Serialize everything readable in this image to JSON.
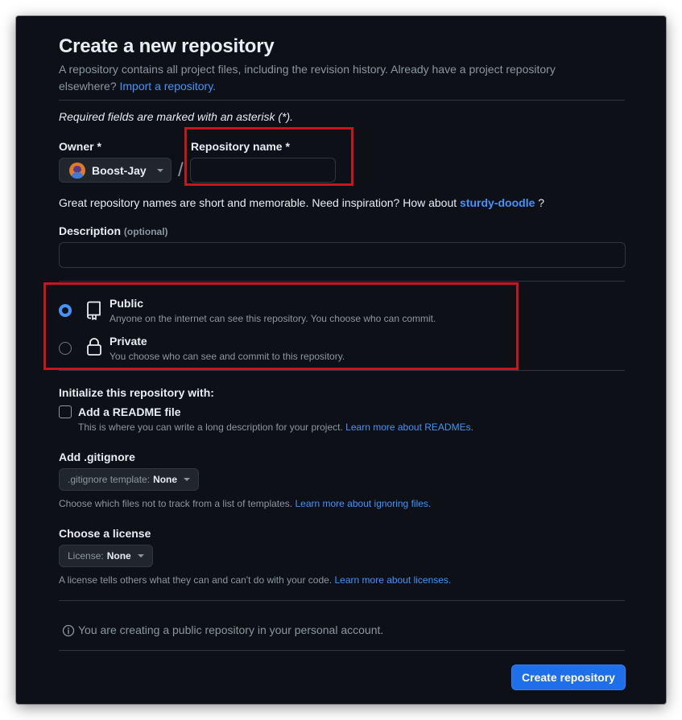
{
  "page": {
    "title": "Create a new repository",
    "subtitle_text": "A repository contains all project files, including the revision history. Already have a project repository elsewhere?",
    "import_link": "Import a repository.",
    "required_note": "Required fields are marked with an asterisk (*)."
  },
  "owner": {
    "label": "Owner *",
    "value": "Boost-Jay"
  },
  "repo_name": {
    "label": "Repository name *",
    "value": "",
    "placeholder": ""
  },
  "separator": "/",
  "name_hint": {
    "text": "Great repository names are short and memorable. Need inspiration? How about",
    "suggestion": "sturdy-doodle",
    "end": "?"
  },
  "description": {
    "label": "Description",
    "optional": "(optional)",
    "value": ""
  },
  "visibility": {
    "selected": "public",
    "public": {
      "title": "Public",
      "desc": "Anyone on the internet can see this repository. You choose who can commit."
    },
    "private": {
      "title": "Private",
      "desc": "You choose who can see and commit to this repository."
    }
  },
  "init": {
    "heading": "Initialize this repository with:",
    "readme": {
      "label": "Add a README file",
      "checked": false,
      "desc": "This is where you can write a long description for your project.",
      "link": "Learn more about READMEs."
    }
  },
  "gitignore": {
    "heading": "Add .gitignore",
    "key": ".gitignore template:",
    "value": "None",
    "desc": "Choose which files not to track from a list of templates.",
    "link": "Learn more about ignoring files."
  },
  "license": {
    "heading": "Choose a license",
    "key": "License:",
    "value": "None",
    "desc": "A license tells others what they can and can't do with your code.",
    "link": "Learn more about licenses."
  },
  "info": {
    "text": "You are creating a public repository in your personal account."
  },
  "submit": {
    "label": "Create repository"
  },
  "colors": {
    "background": "#0d1117",
    "accent": "#4493f8",
    "primary_button": "#1f6feb",
    "highlight_box": "#c8141e"
  }
}
